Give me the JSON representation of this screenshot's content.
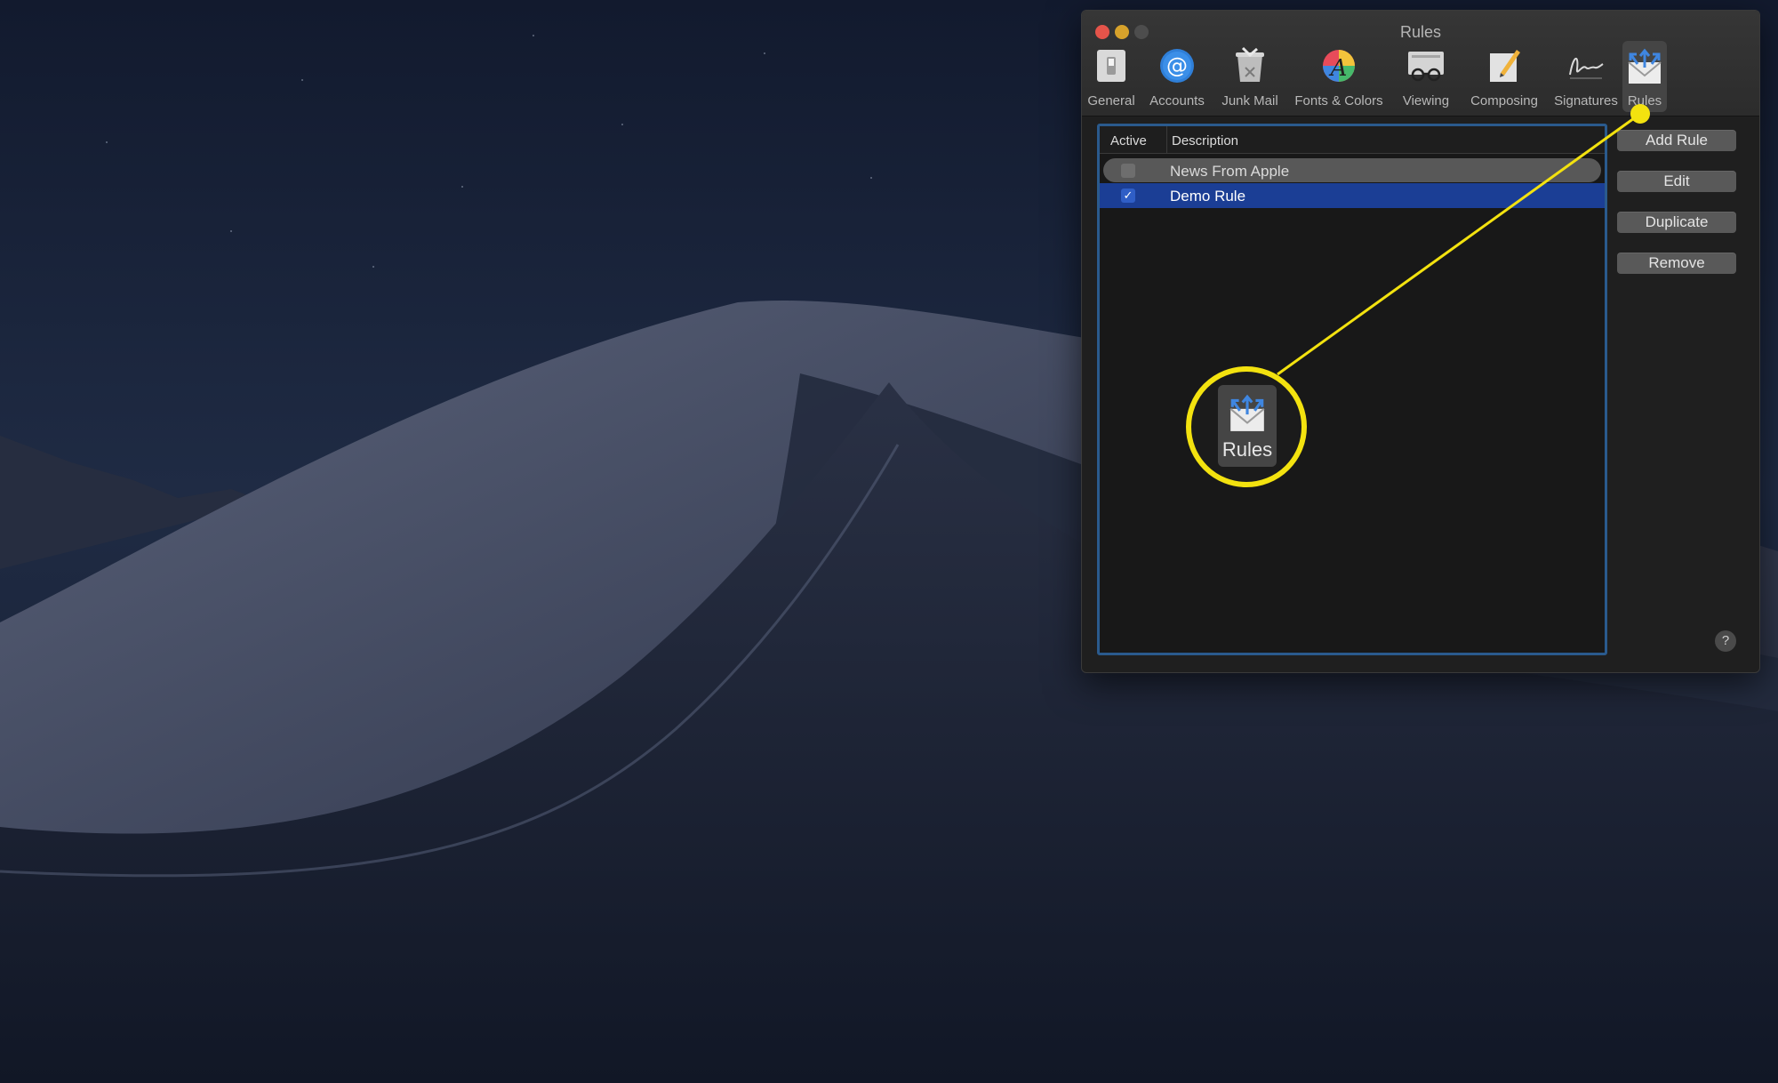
{
  "window": {
    "title": "Rules"
  },
  "toolbar": {
    "items": [
      {
        "label": "General",
        "icon": "general-switch-icon"
      },
      {
        "label": "Accounts",
        "icon": "at-sign-icon"
      },
      {
        "label": "Junk Mail",
        "icon": "trash-can-icon"
      },
      {
        "label": "Fonts & Colors",
        "icon": "color-wheel-font-icon"
      },
      {
        "label": "Viewing",
        "icon": "glasses-icon"
      },
      {
        "label": "Composing",
        "icon": "pencil-paper-icon"
      },
      {
        "label": "Signatures",
        "icon": "signature-icon"
      },
      {
        "label": "Rules",
        "icon": "envelope-arrows-icon",
        "selected": true
      }
    ]
  },
  "table": {
    "columns": [
      "Active",
      "Description"
    ],
    "rows": [
      {
        "active": false,
        "description": "News From Apple",
        "state": "hover"
      },
      {
        "active": true,
        "description": "Demo Rule",
        "state": "selected"
      }
    ]
  },
  "buttons": {
    "add_rule": "Add Rule",
    "edit": "Edit",
    "duplicate": "Duplicate",
    "remove": "Remove",
    "help": "?"
  },
  "callout": {
    "label": "Rules",
    "icon": "envelope-arrows-icon",
    "color": "#f3e20f"
  },
  "colors": {
    "selection": "#1b3e95",
    "table_border": "#2a5a8d",
    "accent_yellow": "#f3e20f"
  }
}
